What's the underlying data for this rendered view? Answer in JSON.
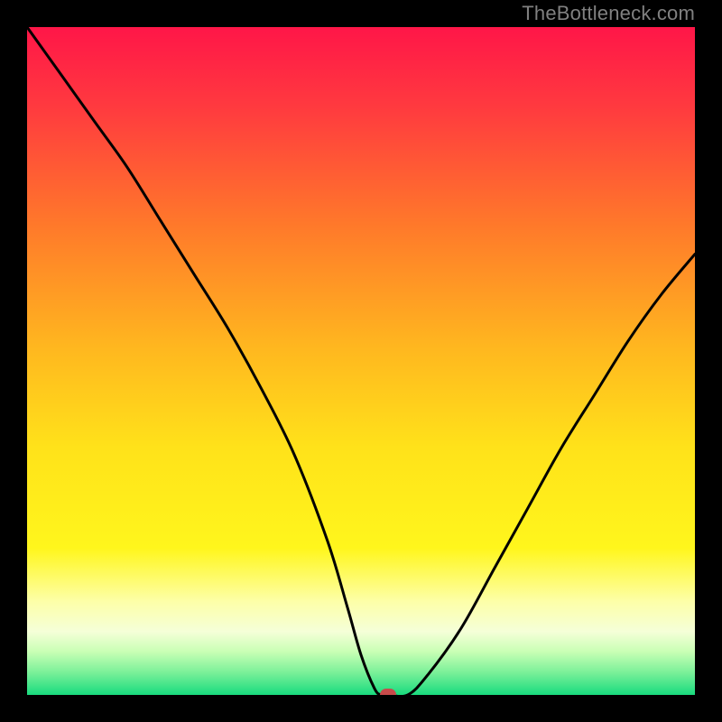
{
  "watermark": "TheBottleneck.com",
  "chart_data": {
    "type": "line",
    "title": "",
    "xlabel": "",
    "ylabel": "",
    "xlim": [
      0,
      100
    ],
    "ylim": [
      0,
      100
    ],
    "grid": false,
    "legend": false,
    "background_gradient": {
      "stops": [
        {
          "offset": 0.0,
          "color": "#ff1648"
        },
        {
          "offset": 0.12,
          "color": "#ff3a3f"
        },
        {
          "offset": 0.3,
          "color": "#ff7a2a"
        },
        {
          "offset": 0.48,
          "color": "#ffb71f"
        },
        {
          "offset": 0.63,
          "color": "#ffe21a"
        },
        {
          "offset": 0.78,
          "color": "#fff61c"
        },
        {
          "offset": 0.86,
          "color": "#fdffa8"
        },
        {
          "offset": 0.905,
          "color": "#f5ffd8"
        },
        {
          "offset": 0.935,
          "color": "#c9ffb5"
        },
        {
          "offset": 0.965,
          "color": "#7ef19a"
        },
        {
          "offset": 1.0,
          "color": "#19db7e"
        }
      ]
    },
    "series": [
      {
        "name": "bottleneck-curve",
        "stroke": "#000000",
        "stroke_width": 3,
        "x": [
          0,
          5,
          10,
          15,
          20,
          25,
          30,
          35,
          40,
          45,
          48,
          50,
          52,
          53,
          54,
          57,
          60,
          65,
          70,
          75,
          80,
          85,
          90,
          95,
          100
        ],
        "y": [
          100,
          93,
          86,
          79,
          71,
          63,
          55,
          46,
          36,
          23,
          13,
          6,
          1,
          0,
          0,
          0,
          3,
          10,
          19,
          28,
          37,
          45,
          53,
          60,
          66
        ]
      }
    ],
    "marker": {
      "name": "optimal-point",
      "x": 54,
      "y": 0,
      "color": "#c74b4b"
    }
  }
}
